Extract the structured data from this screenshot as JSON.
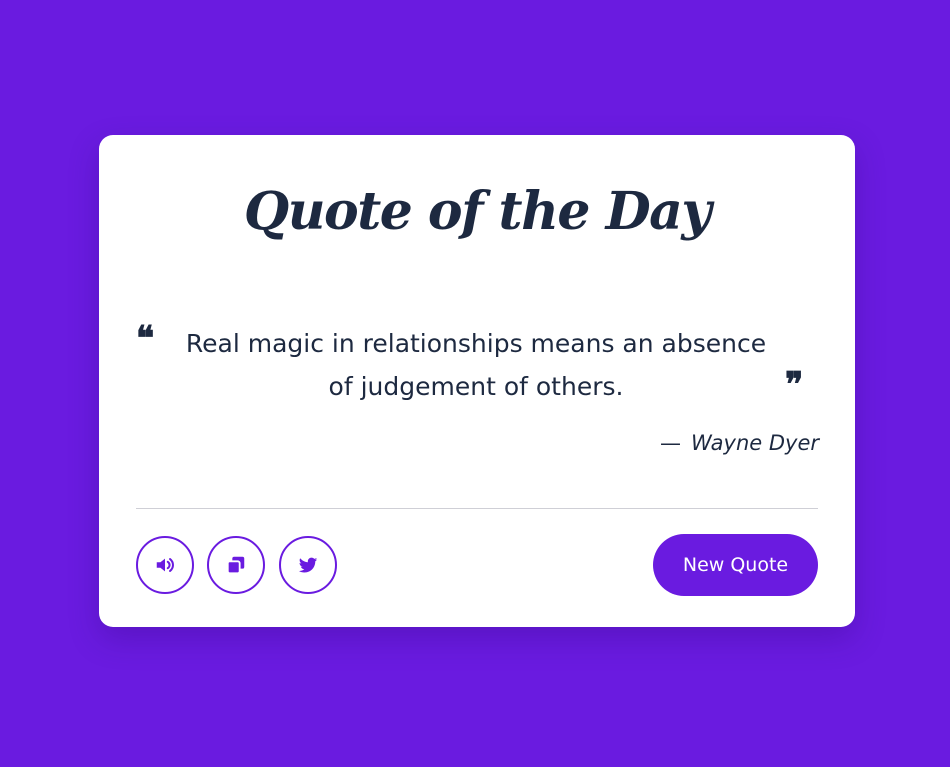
{
  "theme": {
    "background": "#6a1be0",
    "card": "#ffffff",
    "text": "#1d2940",
    "accent": "#6a1be0"
  },
  "card": {
    "title": "Quote of the Day",
    "quote_open_mark": "❝",
    "quote_close_mark": "❞",
    "quote_text": "Real magic in relationships means an absence of judgement of others.",
    "author_dash": "—",
    "author": "Wayne Dyer"
  },
  "actions": {
    "icons": [
      "volume-icon",
      "copy-icon",
      "twitter-icon"
    ],
    "new_quote_label": "New Quote"
  }
}
